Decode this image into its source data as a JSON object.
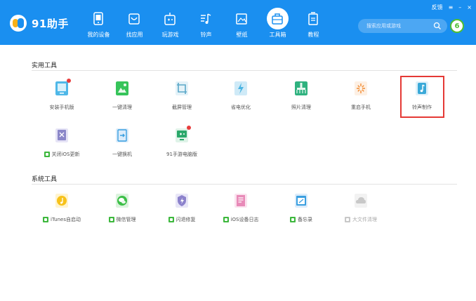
{
  "app": {
    "name": "91助手"
  },
  "nav": [
    {
      "label": "我的设备",
      "icon": "device-icon"
    },
    {
      "label": "找应用",
      "icon": "app-store-icon"
    },
    {
      "label": "玩游戏",
      "icon": "gamepad-icon"
    },
    {
      "label": "铃声",
      "icon": "music-note-icon"
    },
    {
      "label": "壁纸",
      "icon": "image-icon"
    },
    {
      "label": "工具箱",
      "icon": "toolbox-icon",
      "active": true
    },
    {
      "label": "教程",
      "icon": "tutorial-icon"
    }
  ],
  "window": {
    "feedback": "反馈",
    "menu": "≡",
    "minimize": "–",
    "close": "×"
  },
  "search": {
    "placeholder": "搜索应用或游戏"
  },
  "badge": {
    "count": "6"
  },
  "sections": [
    {
      "title": "实用工具",
      "tools": [
        {
          "label": "安装手机版",
          "icon": "tablet-icon",
          "color": "#4fb8e8",
          "dot": true
        },
        {
          "label": "一键清理",
          "icon": "broom-icon",
          "color": "#36c45a"
        },
        {
          "label": "截屏管理",
          "icon": "crop-icon",
          "color": "#5aa7c8"
        },
        {
          "label": "省电优化",
          "icon": "lightning-icon",
          "color": "#4ab4e2"
        },
        {
          "label": "照片清理",
          "icon": "photo-clean-icon",
          "color": "#2fb27f"
        },
        {
          "label": "重启手机",
          "icon": "restart-icon",
          "color": "#f28b30"
        },
        {
          "label": "铃声制作",
          "icon": "ringtone-maker-icon",
          "color": "#3aa9d8",
          "highlighted": true
        },
        {
          "label": "关闭iOS更新",
          "icon": "ios-update-icon",
          "color": "#8b87c9",
          "flag": true
        },
        {
          "label": "一键换机",
          "icon": "phone-transfer-icon",
          "color": "#3a9fe0"
        },
        {
          "label": "91手游电脑版",
          "icon": "pc-game-icon",
          "color": "#2aa86a",
          "dot": true
        }
      ]
    },
    {
      "title": "系统工具",
      "tools": [
        {
          "label": "iTunes自启动",
          "icon": "itunes-icon",
          "color": "#f7c21a",
          "flag": true
        },
        {
          "label": "微信管理",
          "icon": "wechat-icon",
          "color": "#3cbf47",
          "flag": true
        },
        {
          "label": "闪退修复",
          "icon": "shield-icon",
          "color": "#8c82cc",
          "flag": true
        },
        {
          "label": "iOS设备日志",
          "icon": "log-icon",
          "color": "#e88ab8",
          "flag": true
        },
        {
          "label": "备忘录",
          "icon": "memo-icon",
          "color": "#3a9fe0",
          "flag": true
        },
        {
          "label": "大文件清理",
          "icon": "cloud-icon",
          "color": "#c8c8c8",
          "flag": true,
          "disabled": true
        }
      ]
    }
  ]
}
